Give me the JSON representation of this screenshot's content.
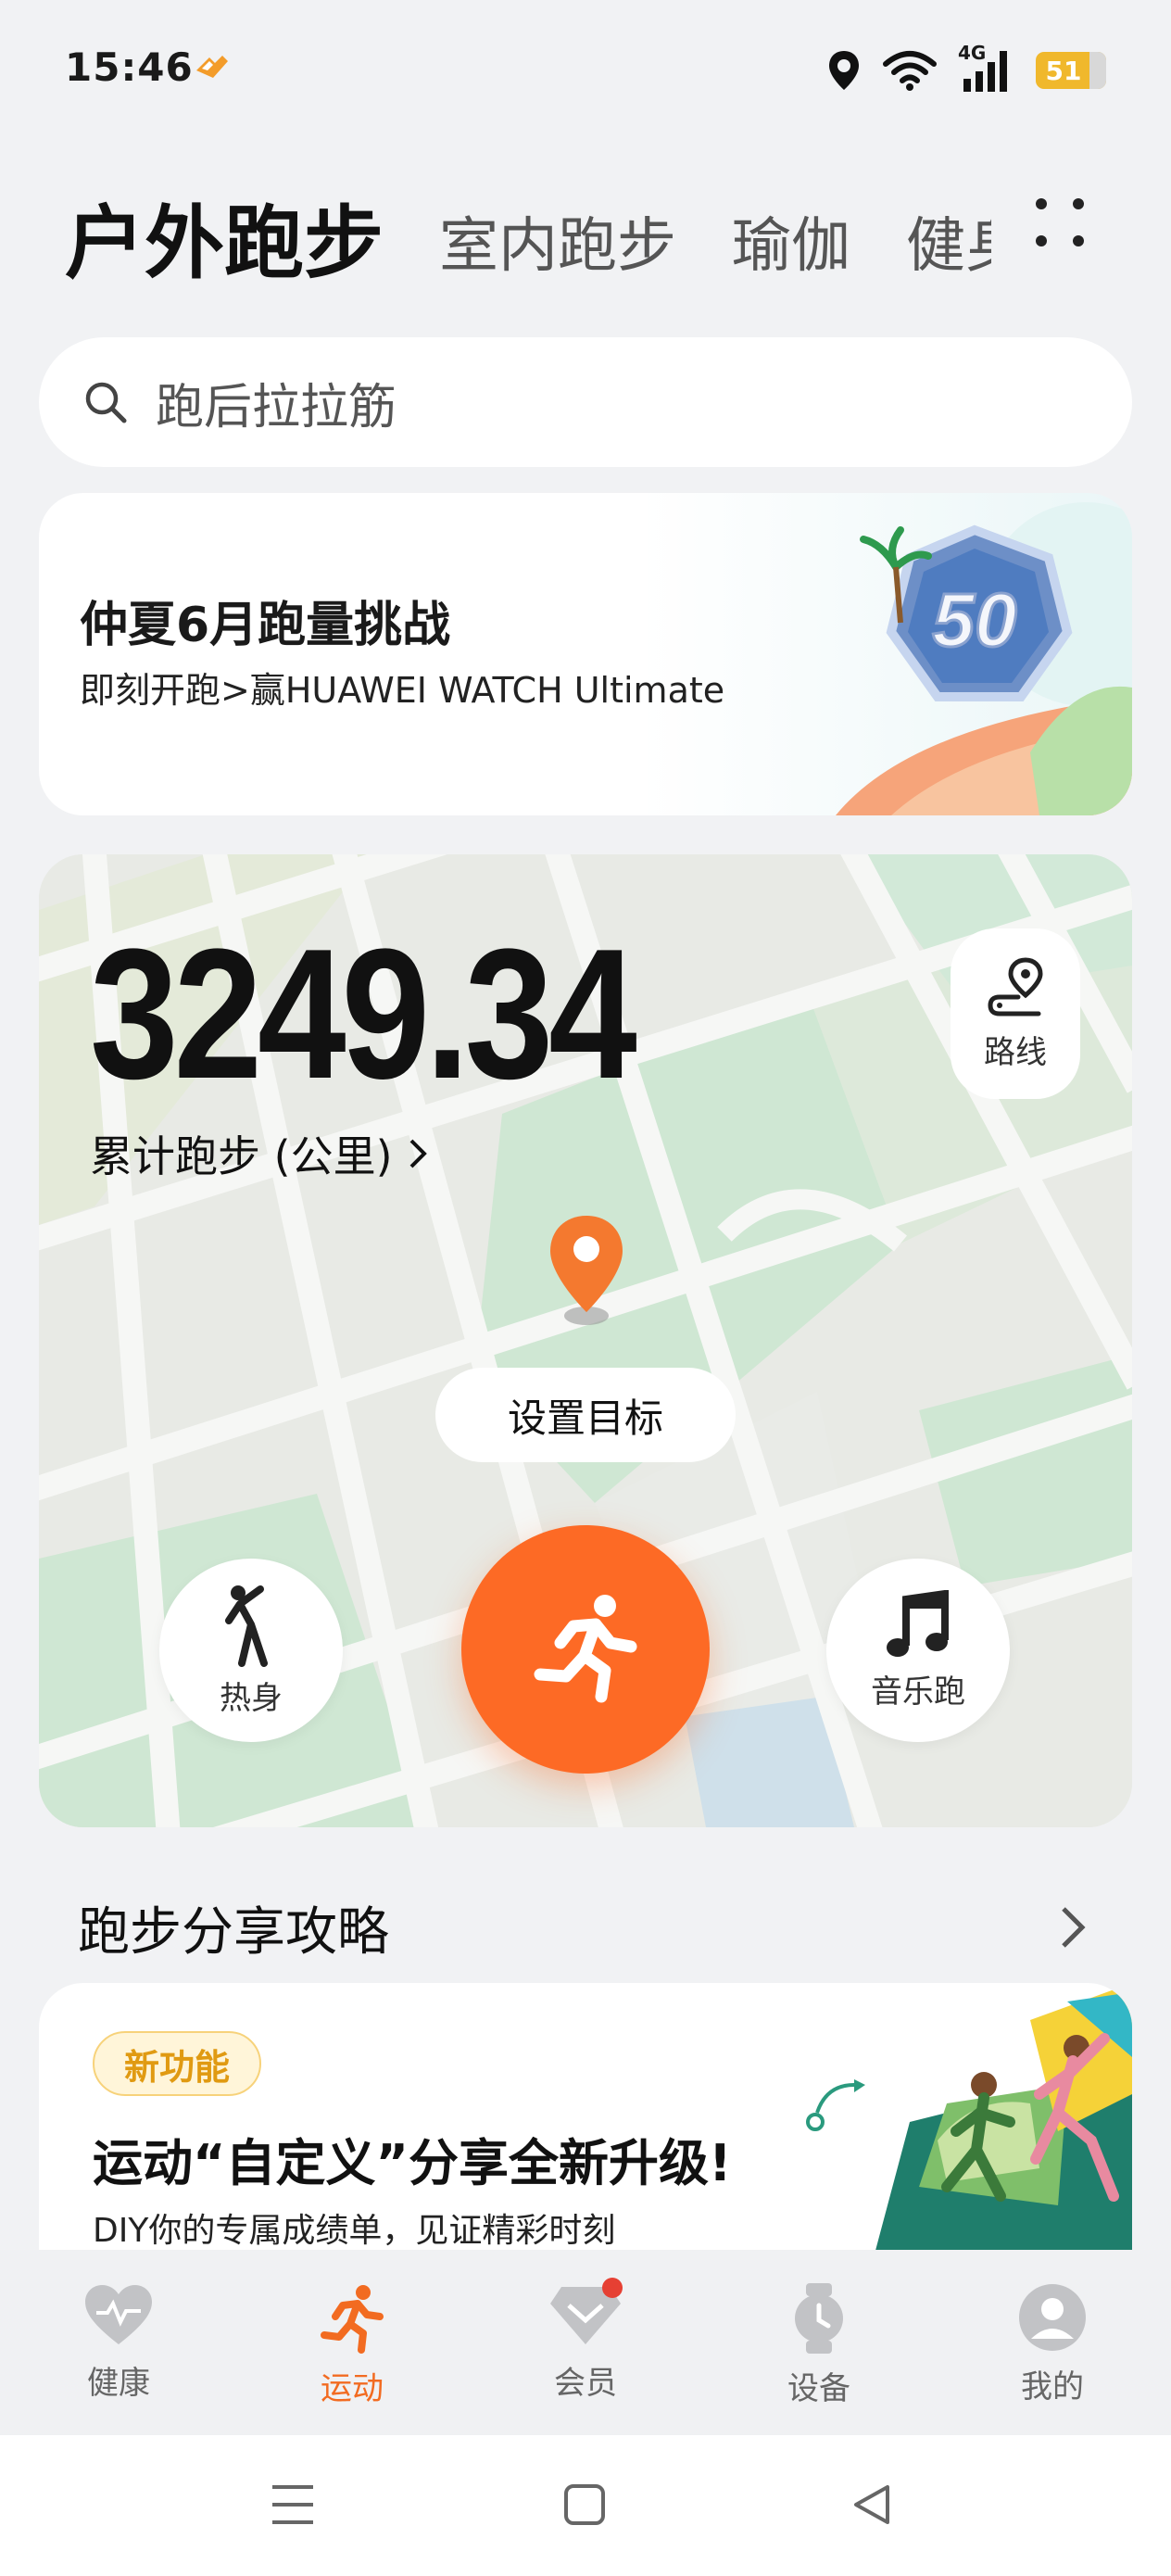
{
  "status_bar": {
    "time": "15:46",
    "network": "4G",
    "battery": "51"
  },
  "tabs": [
    {
      "label": "户外跑步",
      "active": true
    },
    {
      "label": "室内跑步",
      "active": false
    },
    {
      "label": "瑜伽",
      "active": false
    },
    {
      "label": "健身",
      "active": false
    }
  ],
  "search": {
    "placeholder": "跑后拉拉筋"
  },
  "banner": {
    "title": "仲夏6月跑量挑战",
    "subtitle": "即刻开跑>赢HUAWEI WATCH Ultimate",
    "badge_number": "50"
  },
  "run_card": {
    "total_distance": "3249.34",
    "total_label": "累计跑步 (公里)",
    "route_label": "路线",
    "set_goal_label": "设置目标",
    "warmup_label": "热身",
    "music_run_label": "音乐跑"
  },
  "section": {
    "title": "跑步分享攻略"
  },
  "promo": {
    "badge": "新功能",
    "title": "运动“自定义”分享全新升级!",
    "subtitle": "DIY你的专属成绩单，见证精彩时刻"
  },
  "bottom_nav": [
    {
      "label": "健康",
      "icon": "heart-pulse-icon",
      "active": false
    },
    {
      "label": "运动",
      "icon": "runner-icon",
      "active": true
    },
    {
      "label": "会员",
      "icon": "diamond-icon",
      "active": false,
      "has_dot": true
    },
    {
      "label": "设备",
      "icon": "watch-icon",
      "active": false
    },
    {
      "label": "我的",
      "icon": "avatar-icon",
      "active": false
    }
  ],
  "colors": {
    "accent": "#fd6a25",
    "active_nav": "#f26b21",
    "badge_bg": "#fff5d9"
  }
}
